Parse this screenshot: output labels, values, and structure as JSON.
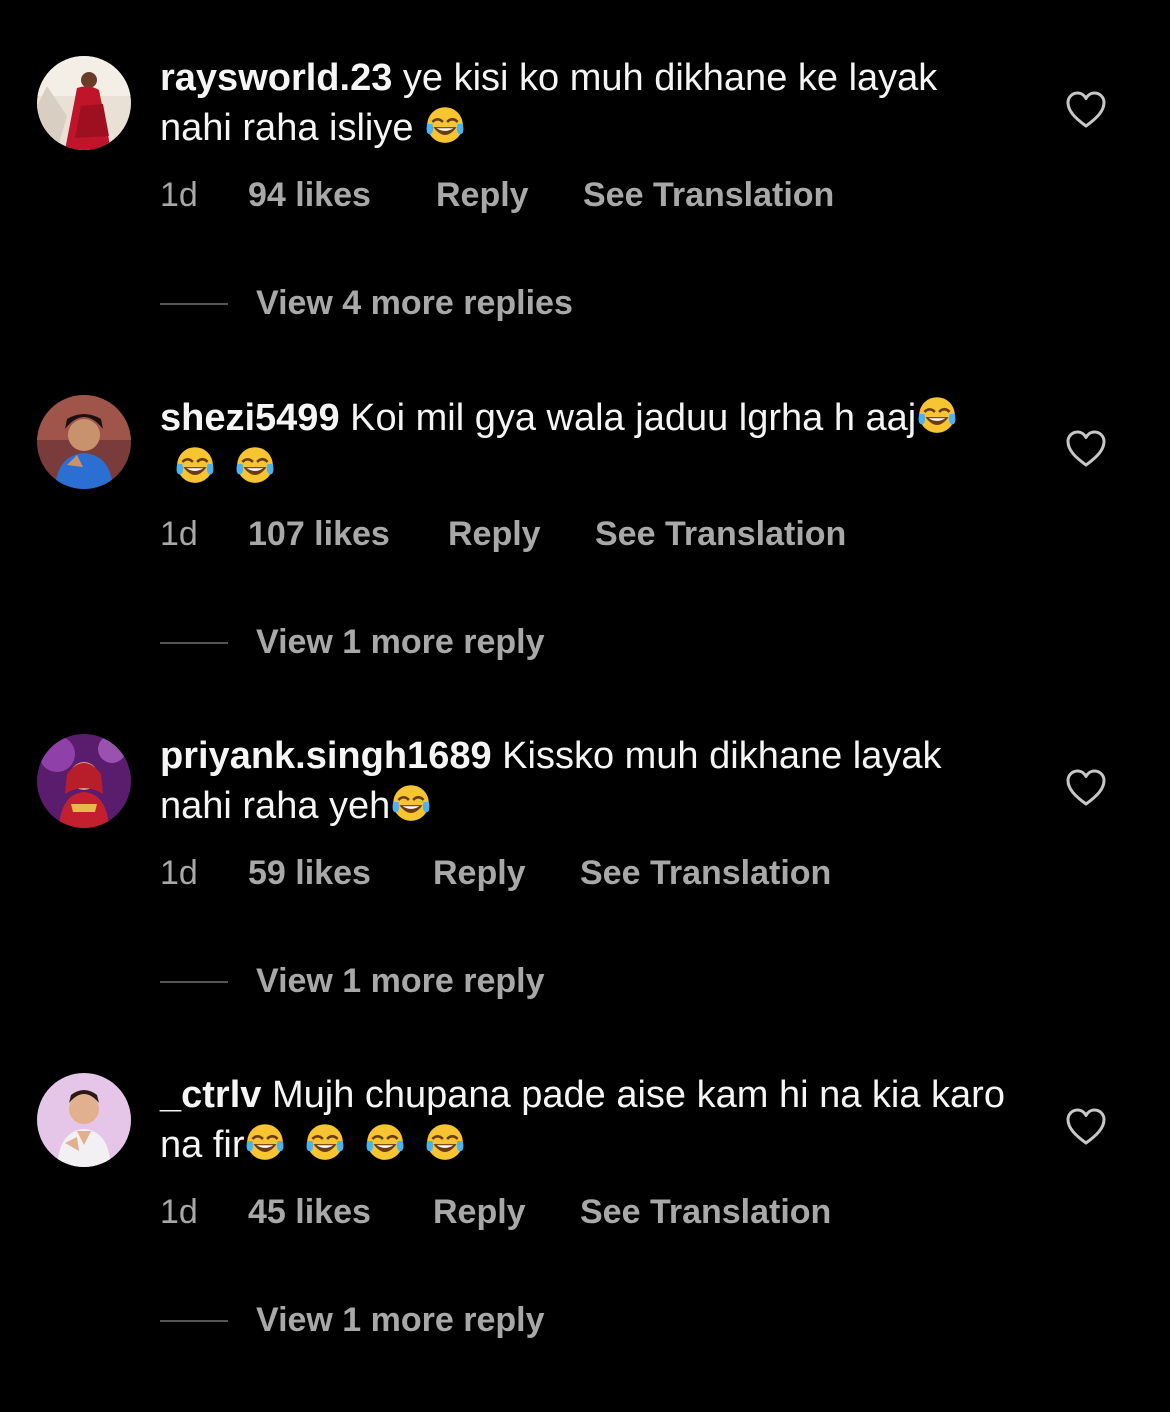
{
  "comments": [
    {
      "username": "raysworld.23",
      "text": "ye kisi ko muh dikhane ke layak nahi raha isliye ",
      "emoji_count": 1,
      "time": "1d",
      "likes": "94 likes",
      "reply": "Reply",
      "translate": "See Translation",
      "view_replies": "View 4 more replies",
      "avatar_icon": "avatar-woman-red-dress"
    },
    {
      "username": "shezi5499",
      "text": "Koi mil gya wala jaduu lgrha h aaj",
      "emoji_count": 3,
      "time": "1d",
      "likes": "107 likes",
      "reply": "Reply",
      "translate": "See Translation",
      "view_replies": "View 1 more reply",
      "avatar_icon": "avatar-woman-selfie"
    },
    {
      "username": "priyank.singh1689",
      "text": "Kissko muh dikhane layak nahi raha yeh",
      "emoji_count": 1,
      "time": "1d",
      "likes": "59 likes",
      "reply": "Reply",
      "translate": "See Translation",
      "view_replies": "View 1 more reply",
      "avatar_icon": "avatar-bride"
    },
    {
      "username": "_ctrlv",
      "text": "Mujh chupana pade aise  kam hi na kia karo na fir",
      "emoji_count": 4,
      "time": "1d",
      "likes": "45 likes",
      "reply": "Reply",
      "translate": "See Translation",
      "view_replies": "View 1 more reply",
      "avatar_icon": "avatar-man"
    }
  ],
  "icons": {
    "like": "heart-outline-icon",
    "emoji": "face-with-tears-of-joy-emoji"
  },
  "colors": {
    "background": "#000000",
    "text": "#f5f5f5",
    "muted": "#a8a8a8"
  }
}
